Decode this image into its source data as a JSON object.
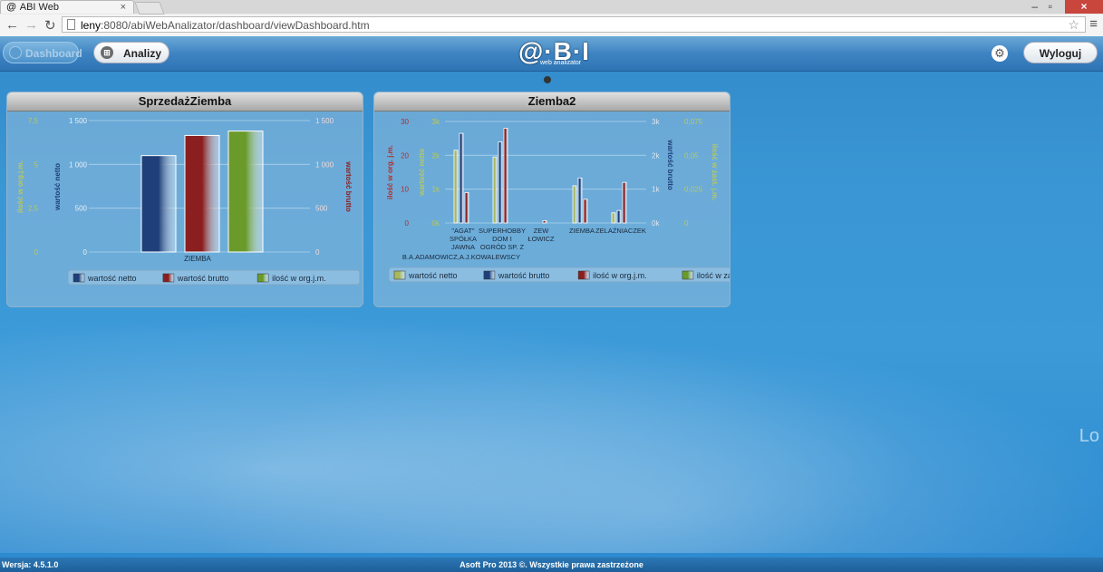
{
  "browser": {
    "tab_title": "ABI Web",
    "tab_icon": "@",
    "tab_close": "×",
    "url_host": "leny",
    "url_rest": ":8080/abiWebAnalizator/dashboard/viewDashboard.htm"
  },
  "appbar": {
    "dashboard_label": "Dashboard",
    "analizy_label": "Analizy",
    "logout_label": "Wyloguj",
    "logo_main": "@·B·I",
    "logo_sub": "web analizator"
  },
  "panel1": {
    "title": "SprzedażZiemba",
    "chart_data": {
      "type": "bar",
      "categories": [
        "ZIEMBA"
      ],
      "series": [
        {
          "name": "wartość netto",
          "values": [
            1100
          ],
          "color": "#1f3f7a"
        },
        {
          "name": "wartość brutto",
          "values": [
            1330
          ],
          "color": "#8b1e1e"
        },
        {
          "name": "ilość w org.j.m.",
          "values": [
            6.9
          ],
          "color": "#6a9a2a"
        }
      ],
      "left_axis_outer": {
        "label": "ilość w org.j.m.",
        "ticks": [
          "7,5",
          "5",
          "2,5",
          "0"
        ],
        "color": "#b8c85a"
      },
      "left_axis_inner": {
        "label": "wartość netto",
        "ticks": [
          "1 500",
          "1 000",
          "500",
          "0"
        ],
        "color": "#1f3f7a"
      },
      "right_axis": {
        "label": "wartość brutto",
        "ticks": [
          "1 500",
          "1 000",
          "500",
          "0"
        ],
        "color": "#8b1e1e"
      },
      "ylim": [
        0,
        1500
      ]
    }
  },
  "panel2": {
    "title": "Ziemba2",
    "chart_data": {
      "type": "bar",
      "categories": [
        "\"AGAT\" SPÓŁKA JAWNA B.A.ADAMOWICZ,A.J.KOWALEWSCY",
        "SUPERHOBBY DOM I OGRÓD SP. Z",
        "ZEW ŁOWICZ",
        "ZIEMBA",
        "ZELAŻNIACZEK"
      ],
      "series": [
        {
          "name": "wartość netto",
          "values": [
            2150,
            1950,
            0,
            1100,
            300
          ],
          "color": "#a8b85a"
        },
        {
          "name": "wartość brutto",
          "values": [
            2650,
            2400,
            0,
            1330,
            370
          ],
          "color": "#1f3f7a"
        },
        {
          "name": "ilość w org.j.m.",
          "values": [
            9,
            28,
            0.7,
            7,
            12
          ],
          "color": "#8b1e1e"
        },
        {
          "name": "ilość w zast. j.m.",
          "values": [
            0,
            0,
            0,
            0,
            0
          ],
          "color": "#6a9a2a"
        }
      ],
      "x_labels": [
        [
          "\"AGAT\"",
          "SPÓŁKA",
          "JAWNA"
        ],
        [
          "SUPERHOBBY",
          "DOM I",
          "OGRÓD SP. Z"
        ],
        [
          "ZEW",
          "ŁOWICZ"
        ],
        [
          "ZIEMBA"
        ],
        [
          "ZELAŻNIACZEK"
        ]
      ],
      "x_label_extra": "B.A.ADAMOWICZ,A.J.KOWALEWSCY",
      "left_axis_outer": {
        "label": "ilość w org. j.m.",
        "ticks": [
          "30",
          "20",
          "10",
          "0"
        ],
        "color": "#b03030"
      },
      "left_axis_inner": {
        "label": "wartość netto",
        "ticks": [
          "3k",
          "2k",
          "1k",
          "0k"
        ],
        "color": "#b8c85a"
      },
      "right_axis_inner": {
        "label": "wartość brutto",
        "ticks": [
          "3k",
          "2k",
          "1k",
          "0k"
        ],
        "color": "#1f3f7a"
      },
      "right_axis_outer": {
        "label": "ilość w zast. j.m.",
        "ticks": [
          "0,075",
          "0,05",
          "0,025",
          "0"
        ],
        "color": "#b8c85a"
      }
    }
  },
  "footer": {
    "version": "Wersja: 4.5.1.0",
    "copyright": "Asoft Pro 2013 ©. Wszystkie prawa zastrzeżone"
  },
  "background_text": "Lo"
}
